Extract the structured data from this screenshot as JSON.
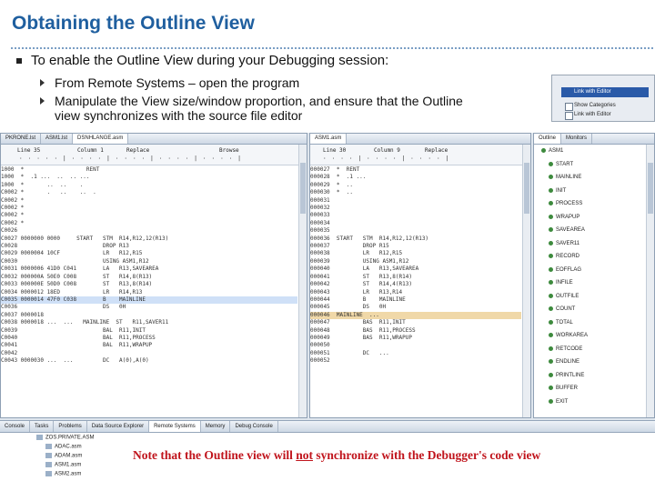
{
  "slide": {
    "title": "Obtaining the Outline View",
    "bullet": "To enable the Outline View during your Debugging session:",
    "sub_bullets": [
      "From Remote Systems – open the program",
      "Manipulate the View size/window proportion, and ensure that the Outline view synchronizes with the source file editor"
    ],
    "note_before": "Note that the Outline view will ",
    "note_emph": "not",
    "note_after": " synchronize with the Debugger's code view"
  },
  "popup": {
    "selected": "Link with Editor",
    "items": [
      "Show Categories",
      "Link with Editor"
    ]
  },
  "ide": {
    "left_tabs": [
      "PKRONE.lst",
      "ASM1.lst",
      "DSNHLANGE.asm"
    ],
    "right_tabs": [
      "ASM1.asm"
    ],
    "outline_tabs": [
      "Outline",
      "Monitors"
    ],
    "left_header": {
      "line": "Line 35",
      "column": "Column 1",
      "mode1": "Replace",
      "mode2": "Browse"
    },
    "right_header": {
      "line": "Line 30",
      "column": "Column 9",
      "mode": "Replace"
    },
    "left_code": [
      "1000  *                   RENT",
      "1000  *  .1 ...  ..  .. ...",
      "1000  *       ..  ..    .",
      "C0002 *       .   ..    ..  .",
      "C0002 *",
      "C0002 *",
      "C0002 *",
      "C0002 *",
      "C0026",
      "C0027 0000000 0000     START   STM  R14,R12,12(R13)",
      "C0028                          DROP R13",
      "C0029 0000004 10CF             LR   R12,R15",
      "C0030                          USING ASM1,R12",
      "C0031 0000006 41D0 C041        LA   R13,SAVEAREA",
      "C0032 000000A 50E0 C008        ST   R14,8(R13)",
      "C0033 000000E 50D0 C008        ST   R13,8(R14)",
      "C0034 0000012 18ED             LR   R14,R13",
      "C0035 0000014 47F0 C038        B    MAINLINE",
      "C0036                          DS   0H",
      "C0037 0000018",
      "C0038 0000018 ...  ...   MAINLINE  ST   R11,SAVER11",
      "C0039                          BAL  R11,INIT",
      "C0040                          BAL  R11,PROCESS",
      "C0041                          BAL  R11,WRAPUP",
      "C0042",
      "C0043 0000030 ...  ...         DC   A(0),A(0)"
    ],
    "right_code": [
      "000027  *  RENT",
      "000028  *  .1 ...",
      "000029  *  ..",
      "000030  *  ..",
      "000031",
      "000032",
      "000033",
      "000034",
      "000035",
      "000036  START   STM  R14,R12,12(R13)",
      "000037          DROP R15",
      "000038          LR   R12,R15",
      "000039          USING ASM1,R12",
      "000040          LA   R13,SAVEAREA",
      "000041          ST   R13,8(R14)",
      "000042          ST   R14,4(R13)",
      "000043          LR   R13,R14",
      "000044          B    MAINLINE",
      "000045          DS   0H",
      "000046  MAINLINE  ...",
      "000047          BAS  R11,INIT",
      "000048          BAS  R11,PROCESS",
      "000049          BAS  R11,WRAPUP",
      "000050",
      "000051          DC   ...",
      "000052"
    ],
    "outline_items": [
      "ASM1",
      "START",
      "MAINLINE",
      "INIT",
      "PROCESS",
      "WRAPUP",
      "SAVEAREA",
      "SAVER11",
      "RECORD",
      "EOFFLAG",
      "INFILE",
      "OUTFILE",
      "COUNT",
      "TOTAL",
      "WORKAREA",
      "RETCODE",
      "ENDLINE",
      "PRINTLINE",
      "BUFFER",
      "EXIT"
    ],
    "bottom_tabs": [
      "Console",
      "Tasks",
      "Problems",
      "Data Source Explorer",
      "Remote Systems",
      "Memory",
      "Debug Console"
    ],
    "bottom_tree": [
      "ZOS.PRIVATE.ASM",
      "ADAC.asm",
      "ADAM.asm",
      "ASM1.asm",
      "ASM2.asm"
    ]
  },
  "colors": {
    "title": "#1f5f9f",
    "note": "#c0141c",
    "selection": "#2a5aa8"
  }
}
